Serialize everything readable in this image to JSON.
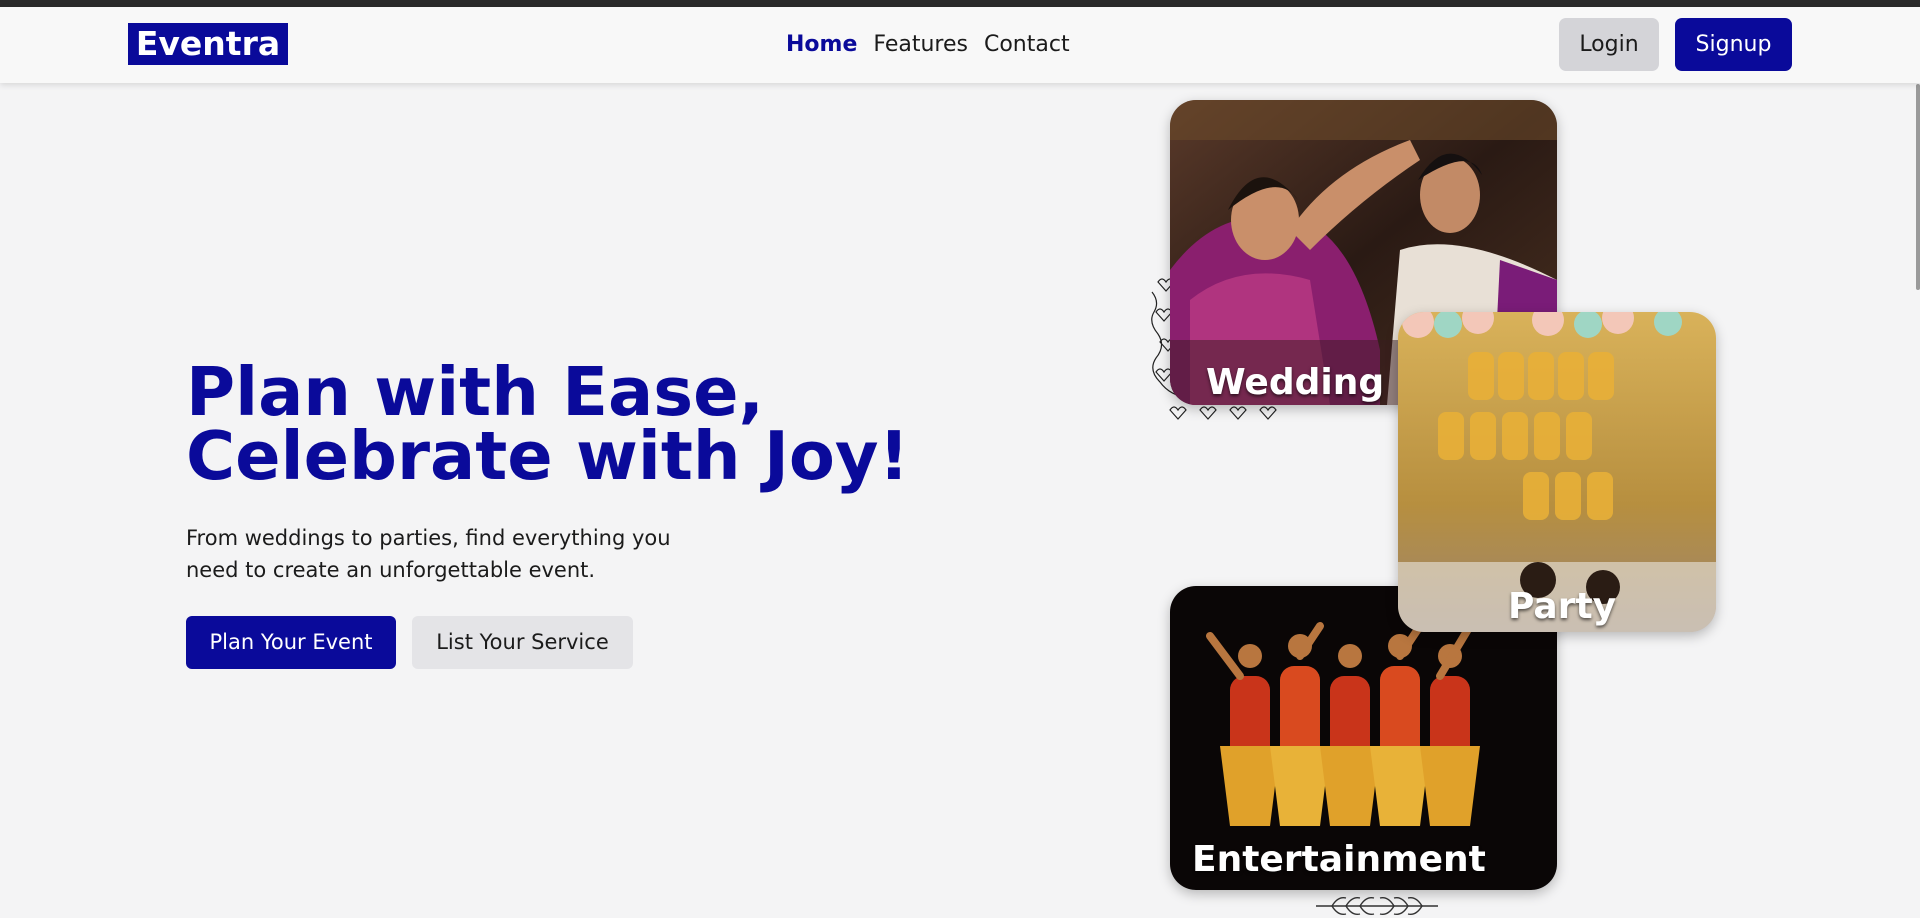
{
  "brand": {
    "logo_text": "Eventra",
    "accent_color": "#0a0a9a"
  },
  "nav": {
    "links": [
      {
        "label": "Home",
        "active": true
      },
      {
        "label": "Features",
        "active": false
      },
      {
        "label": "Contact",
        "active": false
      }
    ],
    "login_label": "Login",
    "signup_label": "Signup"
  },
  "hero": {
    "title_line1": "Plan with Ease,",
    "title_line2": "Celebrate with Joy!",
    "subtitle": "From weddings to parties, find everything you need to create an unforgettable event.",
    "primary_button": "Plan Your Event",
    "secondary_button": "List Your Service"
  },
  "cards": [
    {
      "label": "Wedding",
      "image": "wedding-ceremony-photo"
    },
    {
      "label": "Party",
      "image": "birthday-party-balloons-photo"
    },
    {
      "label": "Entertainment",
      "image": "classical-dance-troupe-photo"
    }
  ]
}
